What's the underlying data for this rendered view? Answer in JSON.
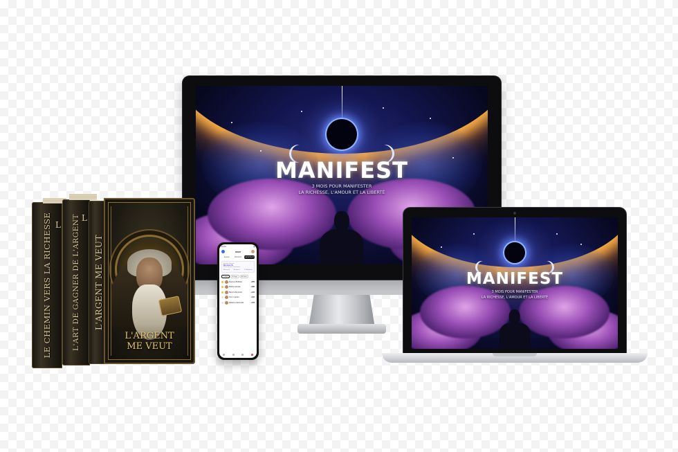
{
  "mockups": {
    "imac": {
      "title": "MANIFEST",
      "subtitle_line1": "3 MOIS POUR MANIFESTER",
      "subtitle_line2": "LA RICHESSE, L'AMOUR ET LA LIBERTÉ"
    },
    "macbook": {
      "title": "MANIFEST",
      "subtitle_line1": "3 MOIS POUR MANIFESTER",
      "subtitle_line2": "LA RICHESSE, L'AMOUR ET LA LIBERTÉ"
    }
  },
  "phone": {
    "time": "12:10",
    "app_name": "VOLT",
    "tabs": [
      "Spaces",
      "Members",
      "Leaderboard"
    ],
    "active_tab": "Leaderboard",
    "card": {
      "welcome": "Bonjour Nicolas",
      "name": "Nicolas B.",
      "note": "Keep up your hard work"
    },
    "stats": [
      "Niveau 8",
      "Niveau 9",
      "1 234 points"
    ],
    "ranges": [
      "7 days",
      "30 days",
      "All time"
    ],
    "leaderboard": [
      {
        "name": "Sleena LESAKAA",
        "score": "+65"
      },
      {
        "name": "Malika Aarissa",
        "score": "+60"
      },
      {
        "name": "Fabrice Boumein",
        "score": "+43"
      },
      {
        "name": "Youri cyprien",
        "score": "+42"
      },
      {
        "name": "Zakaria Arahouets",
        "score": "+34"
      }
    ]
  },
  "books": {
    "spine1": "LE CHEMIN VERS LA RICHESSE",
    "spine1_top": "L",
    "spine2": "L'ART DE GAGNER DE L'ARGENT",
    "spine2_top": "L",
    "spine3": "L'ARGENT ME VEUT",
    "cover_title_line1": "L'ARGENT",
    "cover_title_line2": "ME VEUT"
  },
  "colors": {
    "sky": "#131650",
    "horizon_glow": "#ffb347",
    "cloud": "#9a4fb6",
    "gold": "#e7c56e"
  }
}
